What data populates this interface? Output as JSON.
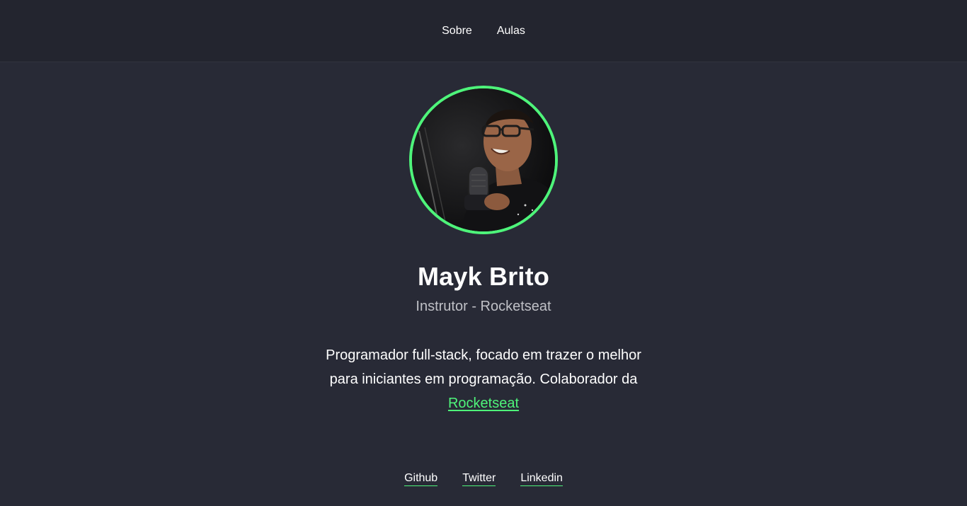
{
  "nav": {
    "items": [
      "Sobre",
      "Aulas"
    ]
  },
  "profile": {
    "name": "Mayk Brito",
    "role": "Instrutor - Rocketseat",
    "bio_text": "Programador full-stack, focado em trazer o melhor para iniciantes em programação. Colaborador da ",
    "bio_link": "Rocketseat"
  },
  "social": {
    "items": [
      "Github",
      "Twitter",
      "Linkedin"
    ]
  },
  "colors": {
    "accent": "#4ef47a",
    "background": "#282a36",
    "header_bg": "#23252f"
  }
}
